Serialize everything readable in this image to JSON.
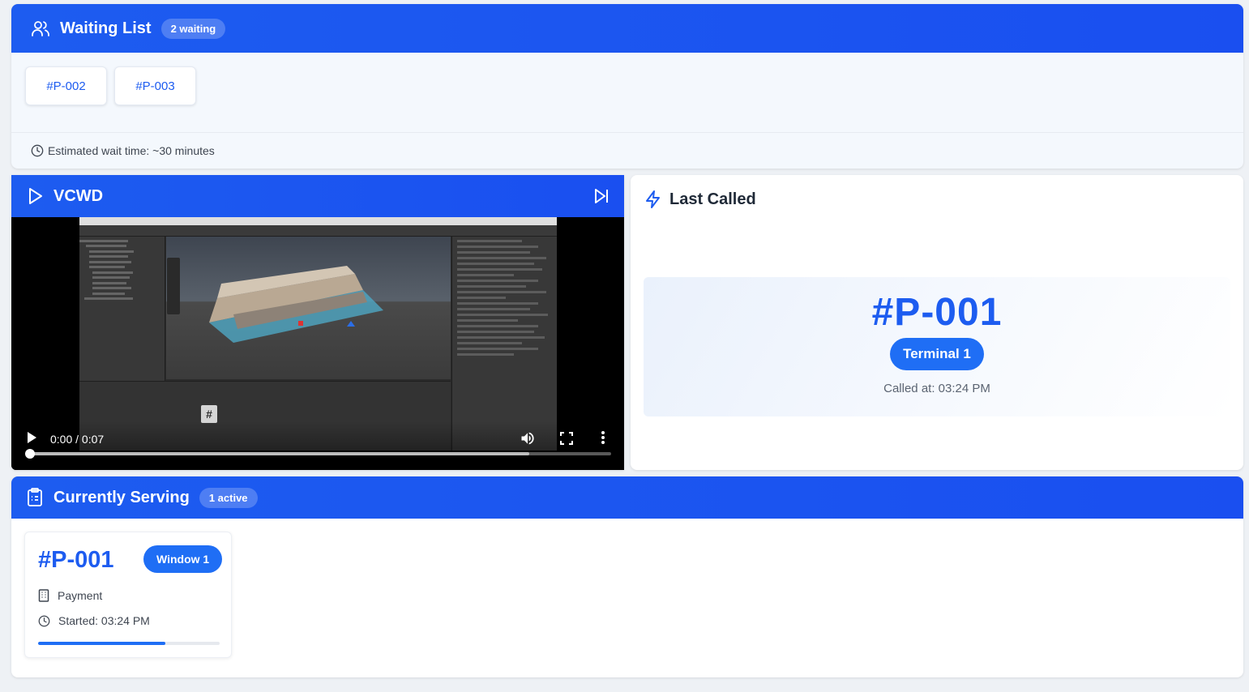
{
  "waiting_list": {
    "title": "Waiting List",
    "badge": "2 waiting",
    "tickets": [
      "#P-002",
      "#P-003"
    ],
    "estimate": "Estimated wait time: ~30 minutes"
  },
  "video": {
    "title": "VCWD",
    "time": "0:00 / 0:07",
    "progress_buffered": 0.86,
    "progress_played": 0
  },
  "last_called": {
    "title": "Last Called",
    "number": "#P-001",
    "terminal": "Terminal 1",
    "called_at": "Called at: 03:24 PM"
  },
  "serving": {
    "title": "Currently Serving",
    "badge": "1 active",
    "card": {
      "number": "#P-001",
      "window": "Window 1",
      "service": "Payment",
      "started": "Started: 03:24 PM",
      "progress": 0.7
    }
  },
  "colors": {
    "accent": "#1d5cf0",
    "button": "#1f6ef5"
  }
}
